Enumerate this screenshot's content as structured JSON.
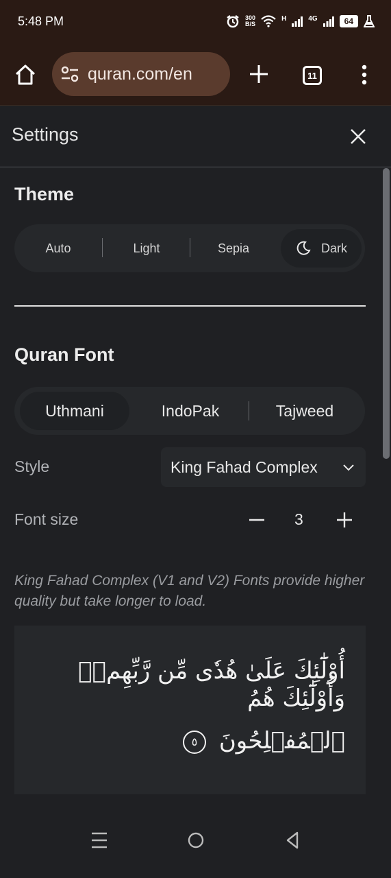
{
  "status_bar": {
    "time": "5:48 PM",
    "net_speed_top": "300",
    "net_speed_bottom": "B/S",
    "signal_a": "H",
    "signal_b": "4G",
    "battery": "64"
  },
  "browser": {
    "url": "quran.com/en",
    "tab_count": "11"
  },
  "settings": {
    "title": "Settings",
    "theme": {
      "title": "Theme",
      "options": [
        "Auto",
        "Light",
        "Sepia",
        "Dark"
      ],
      "selected": "Dark"
    },
    "quran_font": {
      "title": "Quran Font",
      "options": [
        "Uthmani",
        "IndoPak",
        "Tajweed"
      ],
      "selected": "Uthmani",
      "style_label": "Style",
      "style_value": "King Fahad Complex",
      "font_size_label": "Font size",
      "font_size_value": "3",
      "note": "King Fahad Complex (V1 and V2) Fonts provide higher quality but take longer to load.",
      "preview_line1": "أُوْلَٰٓئِكَ عَلَىٰ هُدٗى مِّن رَّبِّهِمۡۖ وَأُوْلَٰٓئِكَ هُمُ",
      "preview_line2": "ٱلۡمُفۡلِحُونَ",
      "ayah_number": "٥"
    }
  },
  "icons": {
    "home": "home-icon",
    "site_settings": "tune-icon",
    "new_tab": "plus-icon",
    "menu": "more-vert-icon",
    "close": "close-icon",
    "dark_mode": "moon-icon",
    "chevron": "chevron-down-icon"
  },
  "colors": {
    "background": "#1f2023",
    "chrome": "#2a1a14",
    "url_pill": "#5a3b2d"
  }
}
